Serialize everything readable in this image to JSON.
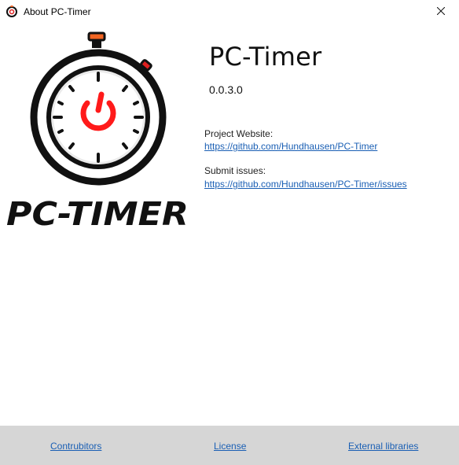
{
  "window": {
    "title": "About PC-Timer",
    "app_icon": "pc-timer-icon",
    "close_icon": "close-icon"
  },
  "logo": {
    "wordmark": "PC-TIMER",
    "accent_color": "#ff1a1a",
    "button_color": "#f26522"
  },
  "about": {
    "app_name": "PC-Timer",
    "version": "0.0.3.0",
    "website_label": "Project Website:",
    "website_url": "https://github.com/Hundhausen/PC-Timer",
    "issues_label": "Submit issues:",
    "issues_url": "https://github.com/Hundhausen/PC-Timer/issues"
  },
  "footer": {
    "contributors": "Contrubitors",
    "license": "License",
    "external_libraries": "External libraries"
  },
  "colors": {
    "link": "#1a5fb4",
    "footer_bg": "#d6d6d6"
  }
}
